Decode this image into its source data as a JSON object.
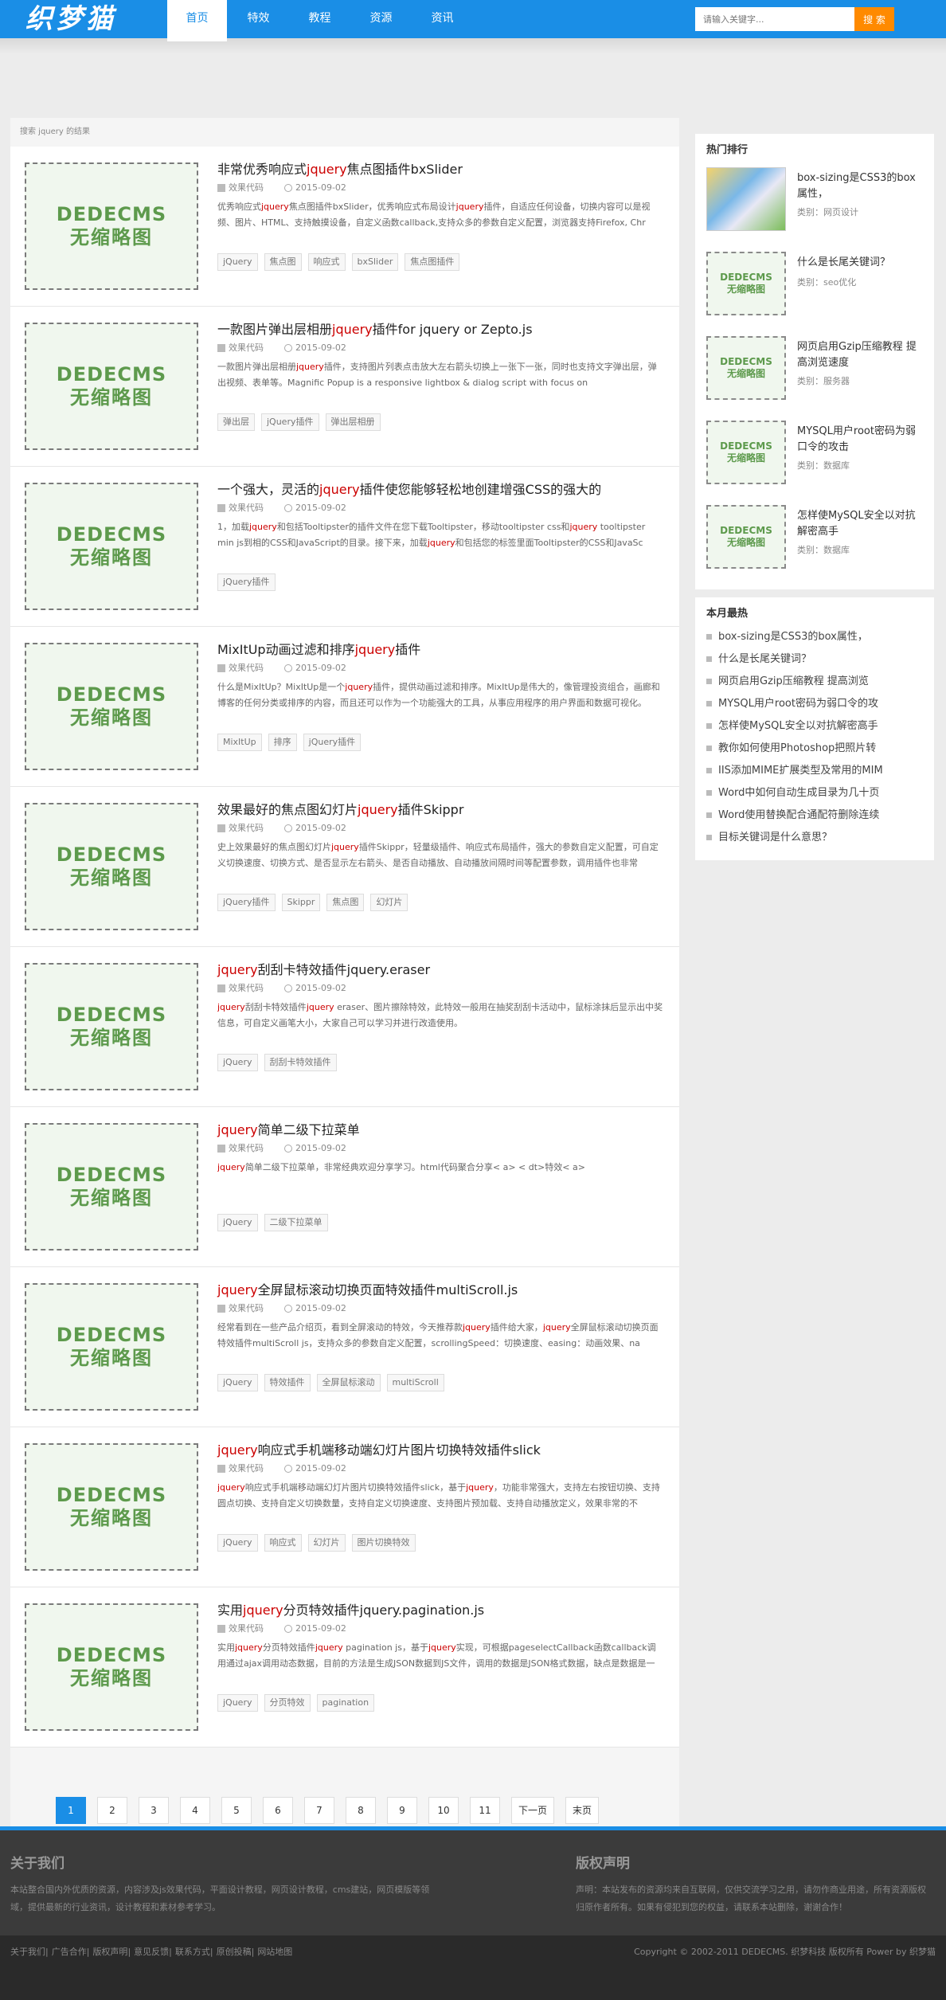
{
  "header": {
    "logo": "织梦猫",
    "nav": [
      "首页",
      "特效",
      "教程",
      "资源",
      "资讯"
    ],
    "search_placeholder": "请输入关键字...",
    "search_button": "搜 索"
  },
  "crumb": "搜索 jquery 的结果",
  "thumb_text": {
    "line1": "DEDECMS",
    "line2": "无缩略图"
  },
  "items": [
    {
      "title_pre": "非常优秀响应式",
      "title_hl": "jquery",
      "title_post": "焦点图插件bxSlider",
      "cat": "效果代码",
      "date": "2015-09-02",
      "desc": "优秀响应式jquery焦点图插件bxSlider，优秀响应式布局设计jquery插件，自适应任何设备，切换内容可以是视频、图片、HTML、支持触摸设备，自定义函数callback,支持众多的参数自定义配置，浏览器支持Firefox, Chr",
      "tags": [
        "jQuery",
        "焦点图",
        "响应式",
        "bxSlider",
        "焦点图插件"
      ]
    },
    {
      "title_pre": "一款图片弹出层相册",
      "title_hl": "jquery",
      "title_post": "插件for jquery or Zepto.js",
      "cat": "效果代码",
      "date": "2015-09-02",
      "desc": "一款图片弹出层相册jquery插件，支持图片列表点击放大左右箭头切换上一张下一张，同时也支持文字弹出层，弹出视频、表单等。Magnific Popup is a responsive lightbox & dialog script with focus on",
      "tags": [
        "弹出层",
        "jQuery插件",
        "弹出层相册"
      ]
    },
    {
      "title_pre": "一个强大，灵活的",
      "title_hl": "jquery",
      "title_post": "插件使您能够轻松地创建增强CSS的强大的",
      "cat": "效果代码",
      "date": "2015-09-02",
      "desc": "1，加载jquery和包括Tooltipster的插件文件在您下载Tooltipster，移动tooltipster css和jquery tooltipster min js到相的CSS和JavaScript的目录。接下来，加载jquery和包括您的标签里面Tooltipster的CSS和JavaSc",
      "tags": [
        "jQuery插件"
      ]
    },
    {
      "title_pre": "MixItUp动画过滤和排序",
      "title_hl": "jquery",
      "title_post": "插件",
      "cat": "效果代码",
      "date": "2015-09-02",
      "desc": "什么是MixItUp？MixItUp是一个jquery插件，提供动画过滤和排序。MixItUp是伟大的，像管理投资组合，画廊和博客的任何分类或排序的内容，而且还可以作为一个功能强大的工具，从事应用程序的用户界面和数据可视化。",
      "tags": [
        "MixItUp",
        "排序",
        "jQuery插件"
      ]
    },
    {
      "title_pre": "效果最好的焦点图幻灯片",
      "title_hl": "jquery",
      "title_post": "插件Skippr",
      "cat": "效果代码",
      "date": "2015-09-02",
      "desc": "史上效果最好的焦点图幻灯片jquery插件Skippr，轻量级插件、响应式布局插件，强大的参数自定义配置，可自定义切换速度、切换方式、是否显示左右箭头、是否自动播放、自动播放间隔时间等配置参数，调用插件也非常",
      "tags": [
        "jQuery插件",
        "Skippr",
        "焦点图",
        "幻灯片"
      ]
    },
    {
      "title_pre": "",
      "title_hl": "jquery",
      "title_post": "刮刮卡特效插件jquery.eraser",
      "cat": "效果代码",
      "date": "2015-09-02",
      "desc": "jquery刮刮卡特效插件jquery eraser、图片擦除特效，此特效一般用在抽奖刮刮卡活动中，鼠标涂抹后显示出中奖信息，可自定义画笔大小，大家自己可以学习并进行改造使用。",
      "tags": [
        "jQuery",
        "刮刮卡特效插件"
      ]
    },
    {
      "title_pre": "",
      "title_hl": "jquery",
      "title_post": "简单二级下拉菜单",
      "cat": "效果代码",
      "date": "2015-09-02",
      "desc": "jquery简单二级下拉菜单，非常经典欢迎分享学习。html代码聚合分享< a> < dt>特效< a>",
      "tags": [
        "jQuery",
        "二级下拉菜单"
      ]
    },
    {
      "title_pre": "",
      "title_hl": "jquery",
      "title_post": "全屏鼠标滚动切换页面特效插件multiScroll.js",
      "cat": "效果代码",
      "date": "2015-09-02",
      "desc": "经常看到在一些产品介绍页，看到全屏滚动的特效，今天推荐款jquery插件给大家，jquery全屏鼠标滚动切换页面特效插件multiScroll js，支持众多的参数自定义配置，scrollingSpeed：切换速度、easing：动画效果、na",
      "tags": [
        "jQuery",
        "特效插件",
        "全屏鼠标滚动",
        "multiScroll"
      ]
    },
    {
      "title_pre": "",
      "title_hl": "jquery",
      "title_post": "响应式手机端移动端幻灯片图片切换特效插件slick",
      "cat": "效果代码",
      "date": "2015-09-02",
      "desc": "jquery响应式手机端移动端幻灯片图片切换特效插件slick，基于jquery，功能非常强大，支持左右按钮切换、支持圆点切换、支持自定义切换数量，支持自定义切换速度、支持图片预加载、支持自动播放定义，效果非常的不",
      "tags": [
        "jQuery",
        "响应式",
        "幻灯片",
        "图片切换特效"
      ]
    },
    {
      "title_pre": "实用",
      "title_hl": "jquery",
      "title_post": "分页特效插件jquery.pagination.js",
      "cat": "效果代码",
      "date": "2015-09-02",
      "desc": "实用jquery分页特效插件jquery pagination js，基于jquery实现，可根据pageselectCallback函数callback调用通过ajax调用动态数据，目前的方法是生成JSON数据到JS文件，调用的数据是JSON格式数据，缺点是数据是一",
      "tags": [
        "jQuery",
        "分页特效",
        "pagination"
      ]
    }
  ],
  "pager": [
    "1",
    "2",
    "3",
    "4",
    "5",
    "6",
    "7",
    "8",
    "9",
    "10",
    "11",
    "下一页",
    "末页"
  ],
  "sidebar": {
    "hot_title": "热门排行",
    "hot": [
      {
        "name": "box-sizing是CSS3的box属性，",
        "cat": "类别：网页设计",
        "has_image": true
      },
      {
        "name": "什么是长尾关键词？",
        "cat": "类别：seo优化",
        "has_image": false
      },
      {
        "name": "网页启用Gzip压缩教程 提高浏览速度",
        "cat": "类别：服务器",
        "has_image": false
      },
      {
        "name": "MYSQL用户root密码为弱口令的攻击",
        "cat": "类别：数据库",
        "has_image": false
      },
      {
        "name": "怎样使MySQL安全以对抗解密高手",
        "cat": "类别：数据库",
        "has_image": false
      }
    ],
    "month_title": "本月最热",
    "month": [
      "box-sizing是CSS3的box属性，",
      "什么是长尾关键词？",
      "网页启用Gzip压缩教程 提高浏览",
      "MYSQL用户root密码为弱口令的攻",
      "怎样使MySQL安全以对抗解密高手",
      "教你如何使用Photoshop把照片转",
      "IIS添加MIME扩展类型及常用的MIM",
      "Word中如何自动生成目录为几十页",
      "Word使用替换配合通配符删除连续",
      "目标关键词是什么意思？"
    ]
  },
  "footer": {
    "about_title": "关于我们",
    "about_text": "本站整合国内外优质的资源，内容涉及js效果代码，平面设计教程，网页设计教程，cms建站，网页模版等领域，提供最新的行业资讯，设计教程和素材参考学习。",
    "copy_title": "版权声明",
    "copy_text": "声明：本站发布的资源均来自互联网，仅供交流学习之用，请勿作商业用途，所有资源版权归原作者所有。如果有侵犯到您的权益，请联系本站删除，谢谢合作！",
    "links": [
      "关于我们",
      "广告合作",
      "版权声明",
      "意见反馈",
      "联系方式",
      "原创投稿",
      "网站地图"
    ],
    "copyright": "Copyright © 2002-2011 DEDECMS. 织梦科技 版权所有 Power by 织梦猫"
  },
  "colors": {
    "brand": "#1a8ee6",
    "search_button": "#ff8a00",
    "highlight": "#cc0000"
  }
}
